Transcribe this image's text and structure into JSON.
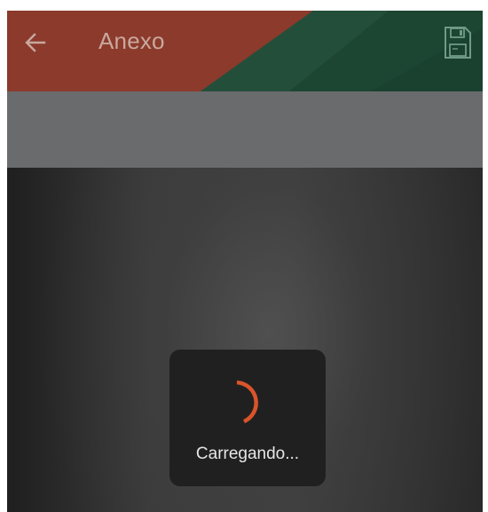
{
  "app_bar": {
    "title": "Anexo",
    "back_icon": "arrow-left-icon",
    "save_icon": "floppy-disk-icon"
  },
  "loading": {
    "text": "Carregando..."
  },
  "colors": {
    "appbar_red": "#8b3a2c",
    "appbar_green": "#1f4a36",
    "spinner_orange": "#d9542b",
    "gray_strip": "#6a6b6d",
    "dialog_bg": "#202020"
  }
}
